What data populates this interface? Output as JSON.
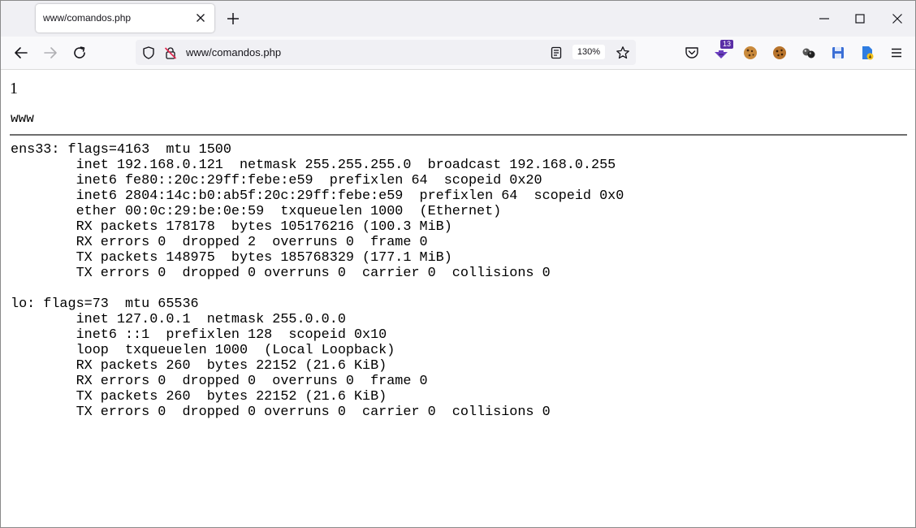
{
  "browser": {
    "tab_title": "www/comandos.php",
    "url": "www/comandos.php",
    "zoom": "130%",
    "extension_badge": "13"
  },
  "page": {
    "heading": "1",
    "hostname": "www",
    "output": "ens33: flags=4163  mtu 1500\n        inet 192.168.0.121  netmask 255.255.255.0  broadcast 192.168.0.255\n        inet6 fe80::20c:29ff:febe:e59  prefixlen 64  scopeid 0x20\n        inet6 2804:14c:b0:ab5f:20c:29ff:febe:e59  prefixlen 64  scopeid 0x0\n        ether 00:0c:29:be:0e:59  txqueuelen 1000  (Ethernet)\n        RX packets 178178  bytes 105176216 (100.3 MiB)\n        RX errors 0  dropped 2  overruns 0  frame 0\n        TX packets 148975  bytes 185768329 (177.1 MiB)\n        TX errors 0  dropped 0 overruns 0  carrier 0  collisions 0\n\nlo: flags=73  mtu 65536\n        inet 127.0.0.1  netmask 255.0.0.0\n        inet6 ::1  prefixlen 128  scopeid 0x10\n        loop  txqueuelen 1000  (Local Loopback)\n        RX packets 260  bytes 22152 (21.6 KiB)\n        RX errors 0  dropped 0  overruns 0  frame 0\n        TX packets 260  bytes 22152 (21.6 KiB)\n        TX errors 0  dropped 0 overruns 0  carrier 0  collisions 0"
  },
  "icons": [
    "close-icon",
    "plus-icon",
    "minimize-icon",
    "maximize-icon",
    "back-icon",
    "forward-icon",
    "reload-icon",
    "shield-icon",
    "insecure-lock-icon",
    "reader-view-icon",
    "star-icon",
    "pocket-icon",
    "download-extension-icon",
    "cookie-icon",
    "cookie-icon",
    "extension-icon",
    "save-icon",
    "bookmark-extension-icon",
    "menu-icon"
  ],
  "colors": {
    "tab_strip": "#f0f0f4",
    "nav_bar": "#f9f9fb",
    "badge": "#5a2ea6",
    "separator": "#6e6e6e"
  }
}
